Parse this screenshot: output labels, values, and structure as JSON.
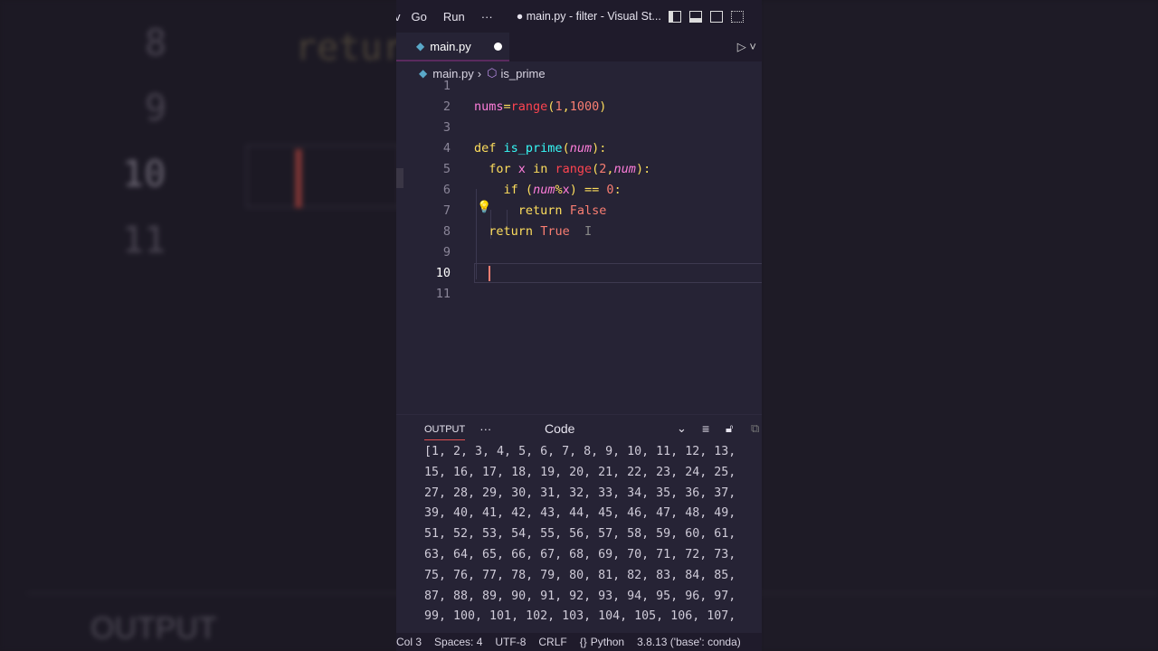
{
  "background": {
    "line_numbers": [
      "8",
      "9",
      "10",
      "11"
    ],
    "code_fragment": "retur",
    "panel_label": "OUTPUT"
  },
  "titlebar": {
    "menu": [
      "v",
      "Go",
      "Run",
      "···"
    ],
    "title": "● main.py - filter - Visual St..."
  },
  "tab": {
    "label": "main.py",
    "icon": "python-icon",
    "modified": true
  },
  "breadcrumb": {
    "file": "main.py",
    "symbol": "is_prime"
  },
  "editor": {
    "line_numbers": [
      "1",
      "2",
      "3",
      "4",
      "5",
      "6",
      "7",
      "8",
      "9",
      "10",
      "11"
    ],
    "active_line": 10
  },
  "panel": {
    "tab": "OUTPUT",
    "more": "···",
    "selector": "Code",
    "lines": [
      "[1, 2, 3, 4, 5, 6, 7, 8, 9, 10, 11, 12, 13,",
      "15, 16, 17, 18, 19, 20, 21, 22, 23, 24, 25,",
      "27, 28, 29, 30, 31, 32, 33, 34, 35, 36, 37,",
      "39, 40, 41, 42, 43, 44, 45, 46, 47, 48, 49,",
      "51, 52, 53, 54, 55, 56, 57, 58, 59, 60, 61,",
      "63, 64, 65, 66, 67, 68, 69, 70, 71, 72, 73,",
      "75, 76, 77, 78, 79, 80, 81, 82, 83, 84, 85,",
      "87, 88, 89, 90, 91, 92, 93, 94, 95, 96, 97,",
      "99, 100, 101, 102, 103, 104, 105, 106, 107,"
    ]
  },
  "status": {
    "col": "Col 3",
    "spaces": "Spaces: 4",
    "encoding": "UTF-8",
    "eol": "CRLF",
    "language": "Python",
    "interpreter": "3.8.13 ('base': conda)"
  },
  "code": {
    "l2": [
      "nums",
      "=",
      "range",
      "(",
      "1",
      "1000",
      ")"
    ],
    "l4": [
      "def",
      "is_prime",
      "(",
      "num",
      "):"
    ],
    "l5": [
      "for",
      "x",
      "in",
      "range",
      "(",
      "2",
      "num",
      "):"
    ],
    "l6": [
      "if",
      "(",
      "num",
      "%",
      "x",
      ")",
      "==",
      "0",
      ":"
    ],
    "l7": [
      "return",
      "False"
    ],
    "l8": [
      "return",
      "True"
    ]
  }
}
